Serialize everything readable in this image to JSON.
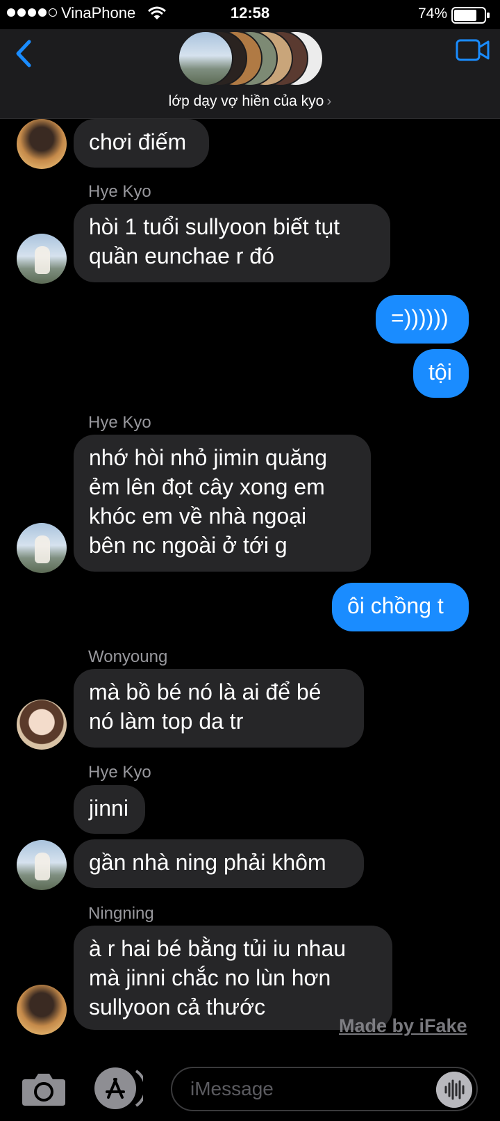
{
  "status_bar": {
    "carrier": "VinaPhone",
    "time": "12:58",
    "battery": "74%"
  },
  "header": {
    "group_name": "lớp dạy vợ hiền của kyo",
    "chevron": "›",
    "back_icon": "chevron-left-icon",
    "video_icon": "video-camera-icon"
  },
  "colors": {
    "accent": "#1a8cff",
    "incoming_bubble": "#262628",
    "background": "#000000"
  },
  "messages": [
    {
      "direction": "in",
      "text_lines": [
        "chơi điếm"
      ]
    },
    {
      "direction": "in",
      "sender": "Hye Kyo",
      "text_lines": [
        "hòi 1 tuổi sullyoon biết tụt",
        "quần eunchae r đó"
      ]
    },
    {
      "direction": "out",
      "text_lines": [
        "=))))))"
      ]
    },
    {
      "direction": "out",
      "text_lines": [
        "tội"
      ]
    },
    {
      "direction": "in",
      "sender": "Hye Kyo",
      "text_lines": [
        "nhớ hòi nhỏ jimin quăng",
        "ẻm lên đọt cây xong em",
        "khóc em về nhà ngoại",
        "bên nc ngoài ở tới g"
      ]
    },
    {
      "direction": "out",
      "text_lines": [
        "ôi chồng t"
      ]
    },
    {
      "direction": "in",
      "sender": "Wonyoung",
      "text_lines": [
        "mà bồ bé nó là ai để bé",
        "nó làm top da tr"
      ]
    },
    {
      "direction": "in",
      "sender": "Hye Kyo",
      "text_lines": [
        "jinni"
      ]
    },
    {
      "direction": "in",
      "text_lines": [
        "gần nhà ning phải khôm"
      ]
    },
    {
      "direction": "in",
      "sender": "Ningning",
      "text_lines": [
        "à r hai bé bằng tủi iu nhau",
        "mà jinni chắc no lùn hơn",
        "sullyoon cả thước"
      ]
    }
  ],
  "watermark": "Made by iFake",
  "input": {
    "placeholder": "iMessage"
  }
}
